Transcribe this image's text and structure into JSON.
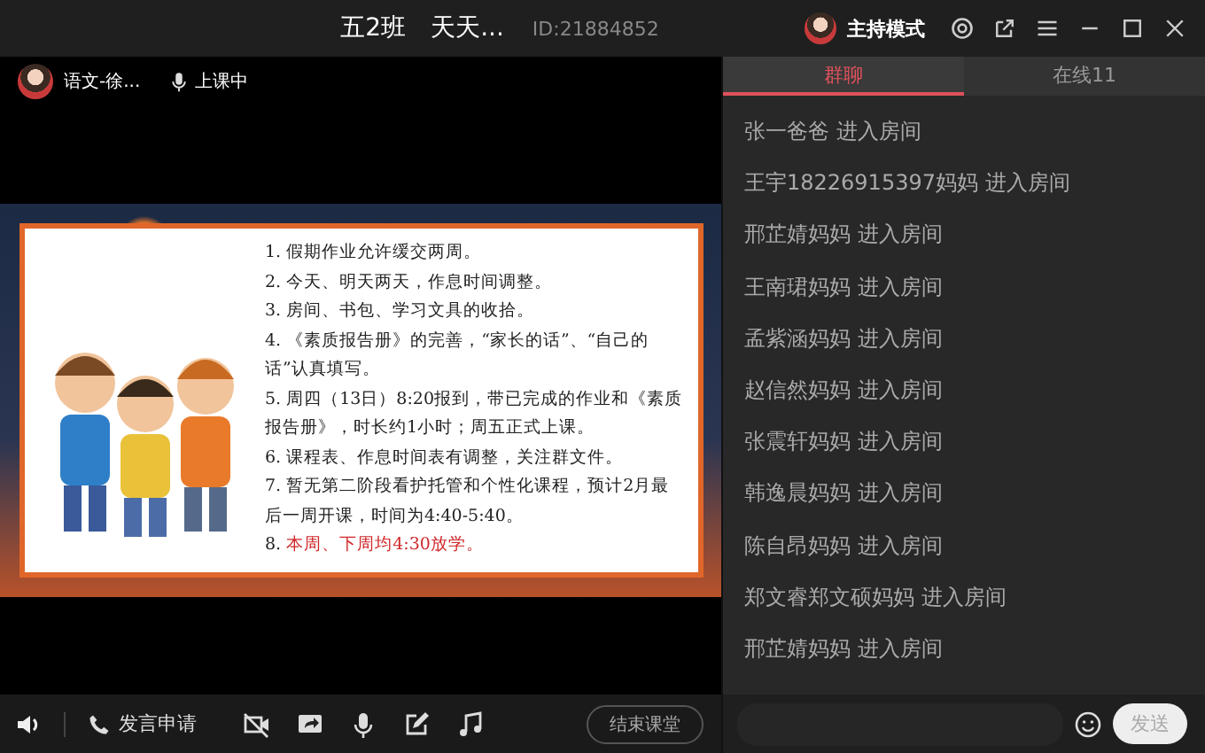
{
  "window": {
    "title": "五2班　天天...",
    "room_id": "ID:21884852",
    "mode": "主持模式"
  },
  "teacher": {
    "name": "语文-徐...",
    "status": "上课中"
  },
  "slide": {
    "items": [
      {
        "number": "1.",
        "text": "假期作业允许缓交两周。",
        "highlight": false
      },
      {
        "number": "2.",
        "text": "今天、明天两天，作息时间调整。",
        "highlight": false
      },
      {
        "number": "3.",
        "text": "房间、书包、学习文具的收拾。",
        "highlight": false
      },
      {
        "number": "4.",
        "text": "《素质报告册》的完善，“家长的话”、“自己的话”认真填写。",
        "highlight": false
      },
      {
        "number": "5.",
        "text": "周四（13日）8:20报到，带已完成的作业和《素质报告册》，时长约1小时；周五正式上课。",
        "highlight": false
      },
      {
        "number": "6.",
        "text": "课程表、作息时间表有调整，关注群文件。",
        "highlight": false
      },
      {
        "number": "7.",
        "text": "暂无第二阶段看护托管和个性化课程，预计2月最后一周开课，时间为4:40-5:40。",
        "highlight": false
      },
      {
        "number": "8.",
        "text": "本周、下周均4:30放学。",
        "highlight": true
      }
    ]
  },
  "toolbar": {
    "speak_request": "发言申请",
    "end_class": "结束课堂"
  },
  "tabs": [
    {
      "label": "群聊",
      "selected": true
    },
    {
      "label": "在线11",
      "selected": false
    }
  ],
  "messages": [
    "张一爸爸 进入房间",
    "王宇18226915397妈妈 进入房间",
    "邢芷婧妈妈 进入房间",
    "王南珺妈妈 进入房间",
    "孟紫涵妈妈 进入房间",
    "赵信然妈妈 进入房间",
    "张震轩妈妈 进入房间",
    "韩逸晨妈妈 进入房间",
    "陈自昂妈妈 进入房间",
    "郑文睿郑文硕妈妈 进入房间",
    "邢芷婧妈妈 进入房间"
  ],
  "chat_input": {
    "send": "发送"
  }
}
